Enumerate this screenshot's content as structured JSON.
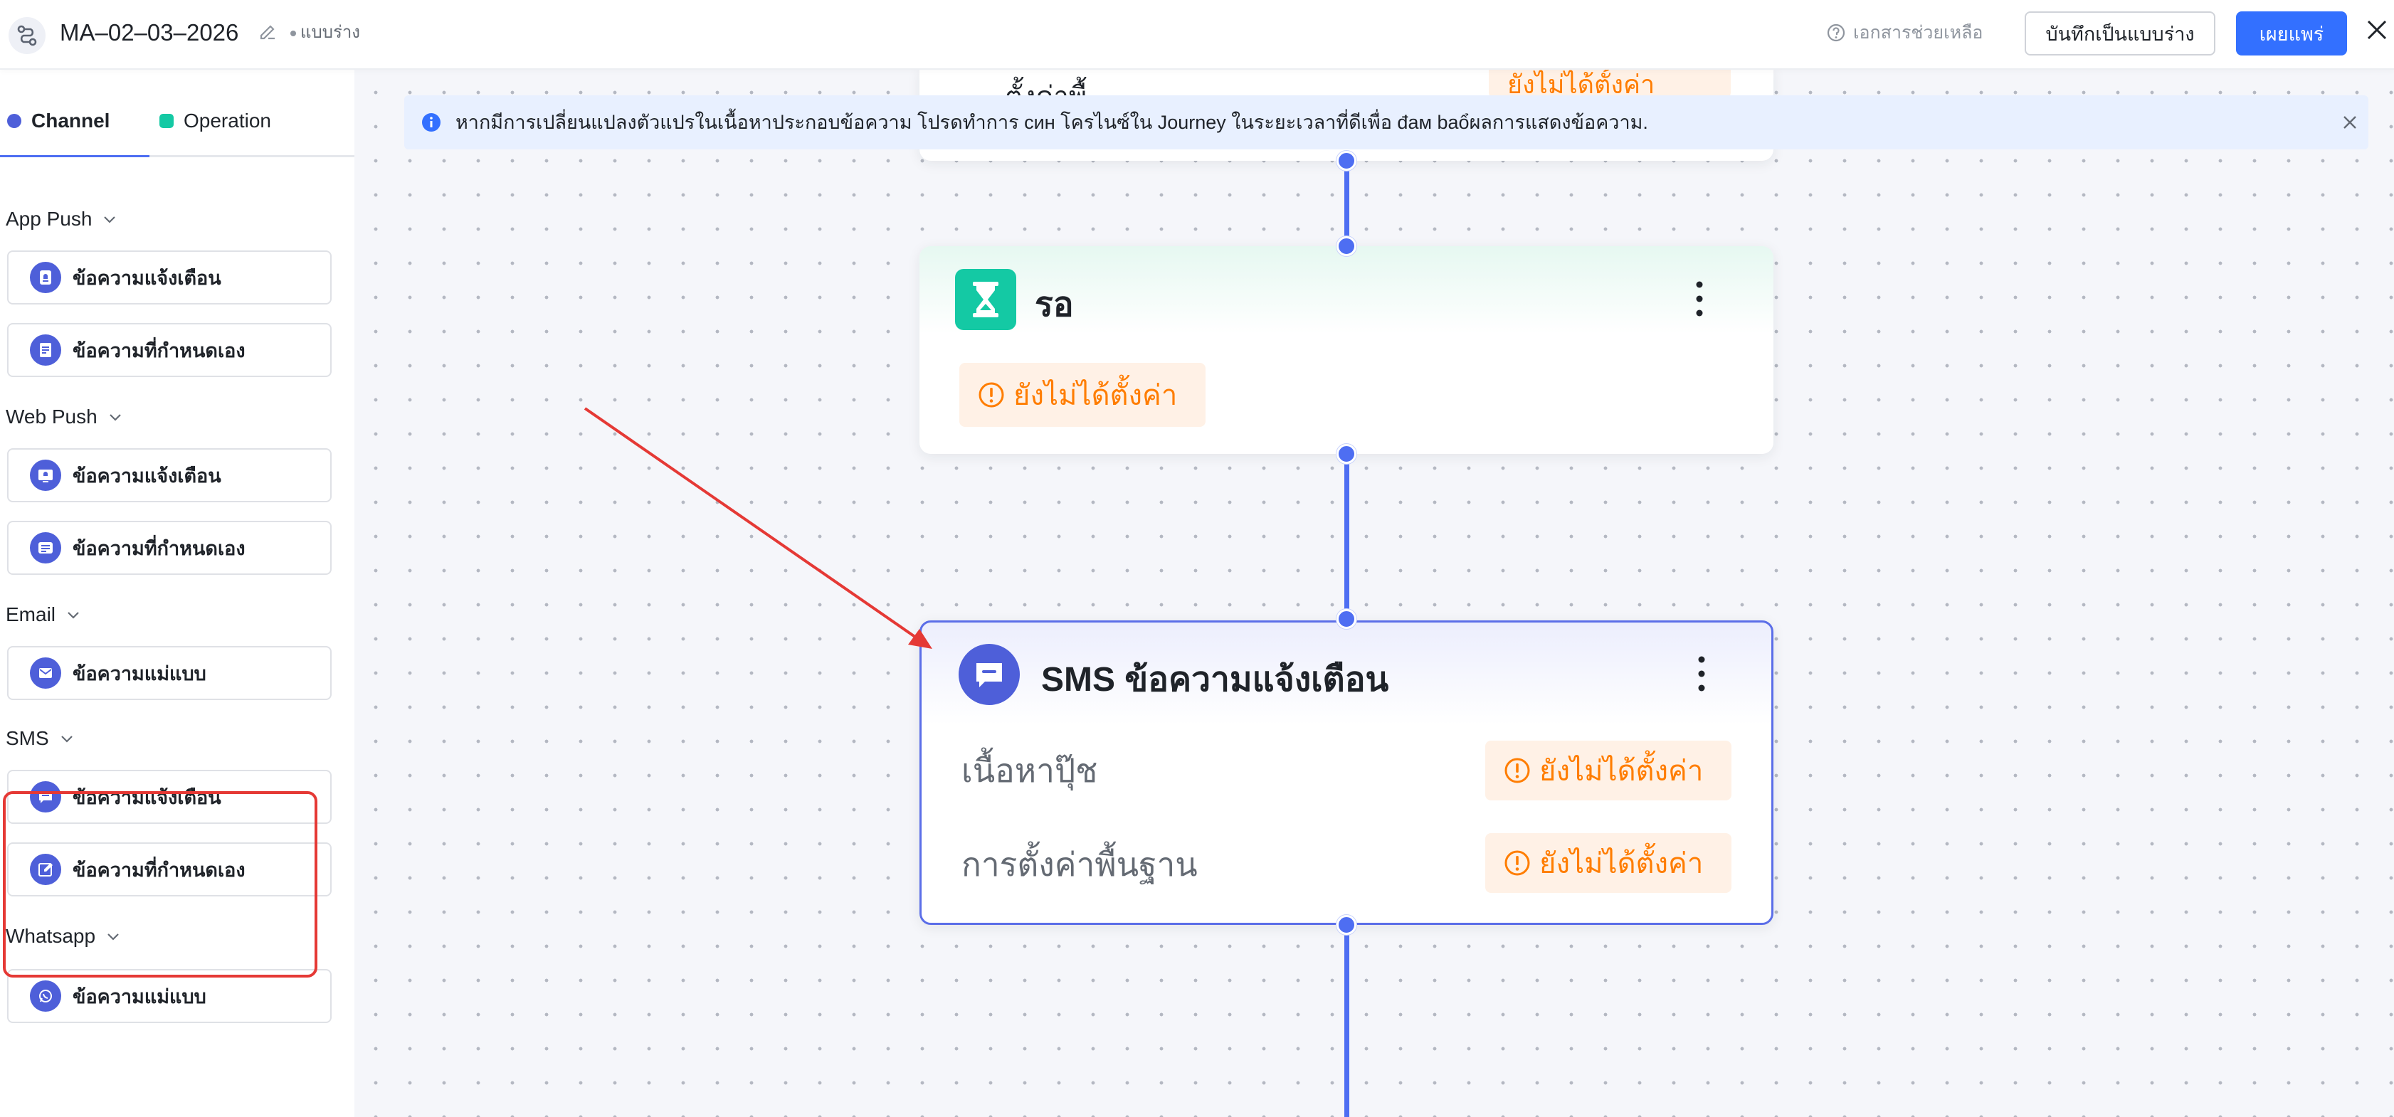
{
  "header": {
    "title": "MA–02–03–2026",
    "status": "แบบร่าง",
    "help_label": "เอกสารช่วยเหลือ",
    "save_draft_label": "บันทึกเป็นแบบร่าง",
    "publish_label": "เผยแพร่"
  },
  "sidebar": {
    "tabs": [
      {
        "label": "Channel",
        "color": "#4e5fd9"
      },
      {
        "label": "Operation",
        "color": "#14c9a4"
      }
    ],
    "groups": [
      {
        "label": "App Push",
        "items": [
          {
            "label": "ข้อความแจ้งเตือน",
            "icon": "bell-message-icon"
          },
          {
            "label": "ข้อความที่กำหนดเอง",
            "icon": "document-icon"
          }
        ]
      },
      {
        "label": "Web Push",
        "items": [
          {
            "label": "ข้อความแจ้งเตือน",
            "icon": "bell-message-icon"
          },
          {
            "label": "ข้อความที่กำหนดเอง",
            "icon": "text-lines-icon"
          }
        ]
      },
      {
        "label": "Email",
        "items": [
          {
            "label": "ข้อความแม่แบบ",
            "icon": "mail-icon"
          }
        ]
      },
      {
        "label": "SMS",
        "items": [
          {
            "label": "ข้อความแจ้งเตือน",
            "icon": "chat-bubble-icon"
          },
          {
            "label": "ข้อความที่กำหนดเอง",
            "icon": "edit-message-icon"
          }
        ]
      },
      {
        "label": "Whatsapp",
        "items": [
          {
            "label": "ข้อความแม่แบบ",
            "icon": "whatsapp-icon"
          }
        ]
      }
    ]
  },
  "canvas": {
    "banner_text": "หากมีการเปลี่ยนแปลงตัวแปรในเนื้อหาประกอบข้อความ โปรดทำการ ᴄᴎʜ โครไนซ์ใน Journey ในระยะเวลาที่ดีเพื่อ đaᴍ baổผลการแสดงข้อความ.",
    "top_card": {
      "partial_label": "ตั้งค่าพื้",
      "warning": "ยังไม่ได้ตั้งค่า"
    },
    "wait_card": {
      "title": "รอ",
      "warning": "ยังไม่ได้ตั้งค่า"
    },
    "sms_card": {
      "title": "SMS ข้อความแจ้งเตือน",
      "rows": [
        {
          "label": "เนื้อหาปุ๊ช",
          "warning": "ยังไม่ได้ตั้งค่า"
        },
        {
          "label": "การตั้งค่าพื้นฐาน",
          "warning": "ยังไม่ได้ตั้งค่า"
        }
      ]
    }
  },
  "colors": {
    "accent": "#4e6ef2",
    "primary_button": "#3370ff",
    "warning": "#ff7d00",
    "annotation": "#e53935",
    "wait_icon": "#14c9a4"
  }
}
